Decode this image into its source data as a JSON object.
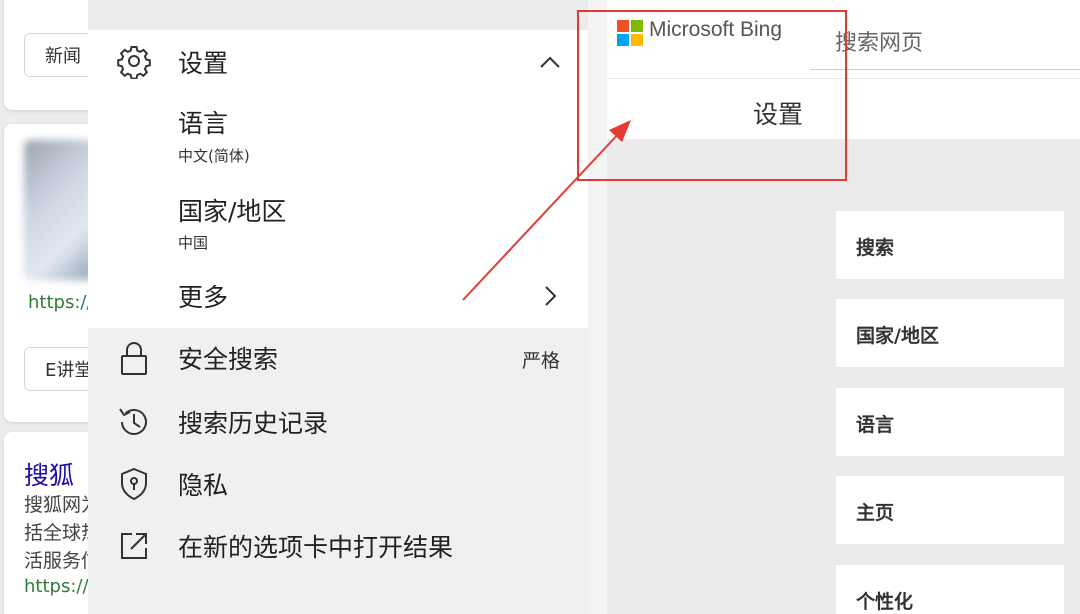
{
  "background_results": {
    "pill_top": "新闻",
    "url_1": "https://v",
    "pill_mid": "E讲堂",
    "title": "搜狐",
    "snippet_lines": [
      "搜狐网为",
      "括全球热",
      "活服务信"
    ],
    "url_2": "https://v"
  },
  "panel": {
    "settings": {
      "label": "设置",
      "icon": "gear-icon",
      "expand_icon": "chevron-up-icon",
      "items": [
        {
          "label": "语言",
          "value": "中文(简体)"
        },
        {
          "label": "国家/地区",
          "value": "中国"
        },
        {
          "label": "更多",
          "icon": "chevron-right-icon"
        }
      ]
    },
    "safe_search": {
      "label": "安全搜索",
      "value": "严格",
      "icon": "lock-icon"
    },
    "history": {
      "label": "搜索历史记录",
      "icon": "history-icon"
    },
    "privacy": {
      "label": "隐私",
      "icon": "shield-icon"
    },
    "new_tab": {
      "label": "在新的选项卡中打开结果",
      "icon": "open-external-icon"
    }
  },
  "bing": {
    "brand": "Microsoft Bing",
    "logo_colors": [
      "#f25022",
      "#7fba00",
      "#00a4ef",
      "#ffb900"
    ],
    "search_placeholder": "搜索网页",
    "page_title": "设置",
    "cards": [
      "搜索",
      "国家/地区",
      "语言",
      "主页",
      "个性化"
    ]
  },
  "annotation_color": "#e53935"
}
